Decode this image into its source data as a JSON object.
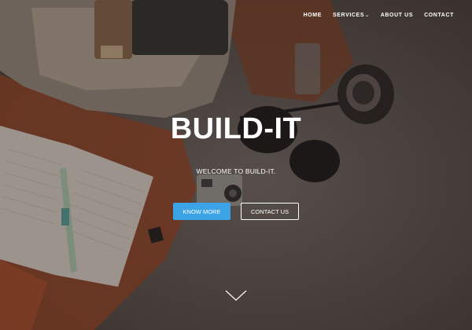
{
  "nav": {
    "home": "HOME",
    "services": "SERVICES",
    "about": "ABOUT US",
    "contact": "CONTACT"
  },
  "hero": {
    "title": "BUILD-IT",
    "subtitle": "WELCOME TO BUILD-IT.",
    "primary_button": "KNOW MORE",
    "secondary_button": "CONTACT US"
  },
  "colors": {
    "primary_button": "#3ba3e6",
    "text": "#ffffff",
    "background": "#4a4340"
  },
  "icons": {
    "services_dropdown": "chevron-down-icon",
    "scroll_down": "chevron-down-icon"
  }
}
